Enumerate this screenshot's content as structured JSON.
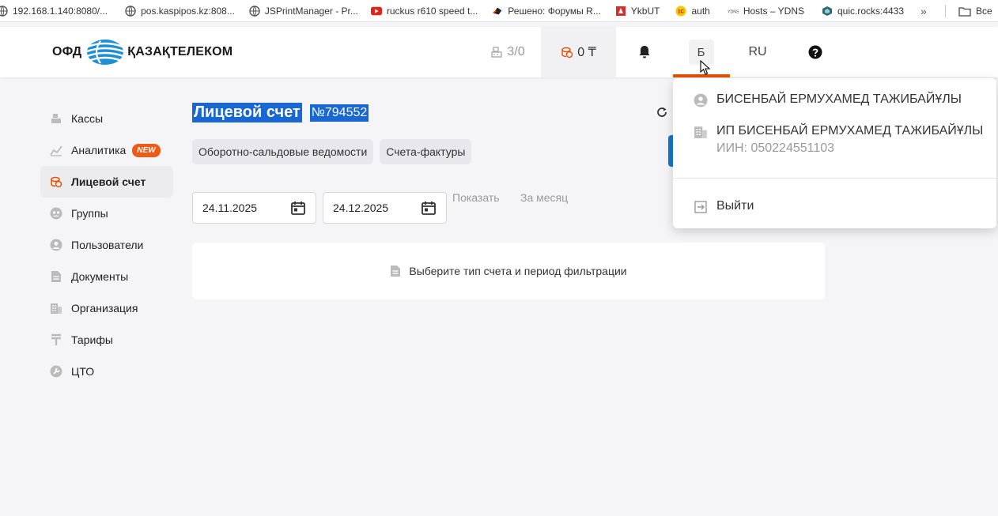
{
  "bookmarks": [
    {
      "label": "192.168.1.140:8080/...",
      "icon": "globe-icon"
    },
    {
      "label": "pos.kaspipos.kz:808...",
      "icon": "globe-icon"
    },
    {
      "label": "JSPrintManager - Pr...",
      "icon": "globe-icon"
    },
    {
      "label": "ruckus r610 speed t...",
      "icon": "youtube-icon"
    },
    {
      "label": "Решено: Форумы R...",
      "icon": "forum-icon"
    },
    {
      "label": "YkbUT",
      "icon": "ykbut-icon"
    },
    {
      "label": "auth",
      "icon": "1c-icon"
    },
    {
      "label": "Hosts – YDNS",
      "icon": "ydns-icon"
    },
    {
      "label": "quic.rocks:4433",
      "icon": "cube-icon"
    }
  ],
  "bookmarks_more": "»",
  "bookmarks_all": "Все",
  "header": {
    "logo_left": "ОФД",
    "logo_right": "ҚАЗАҚТЕЛЕКОМ",
    "kassa_count": "3/0",
    "balance": "0 ₸",
    "user_initial": "Б",
    "lang": "RU"
  },
  "sidebar": {
    "items": [
      {
        "label": "Кассы",
        "icon": "cash-register-icon"
      },
      {
        "label": "Аналитика",
        "icon": "analytics-icon",
        "badge": "NEW"
      },
      {
        "label": "Лицевой счет",
        "icon": "coins-icon",
        "active": true
      },
      {
        "label": "Группы",
        "icon": "groups-icon"
      },
      {
        "label": "Пользователи",
        "icon": "user-icon"
      },
      {
        "label": "Документы",
        "icon": "document-icon"
      },
      {
        "label": "Организация",
        "icon": "building-icon"
      },
      {
        "label": "Тарифы",
        "icon": "tariff-icon"
      },
      {
        "label": "ЦТО",
        "icon": "wrench-icon"
      }
    ]
  },
  "main": {
    "title": "Лицевой счет",
    "account_number": "№794552",
    "chips": [
      "Оборотно-сальдовые ведомости",
      "Счета-фактуры"
    ],
    "date_from": "24.11.2025",
    "date_to": "24.12.2025",
    "show_label": "Показать",
    "month_label": "За месяц",
    "empty_message": "Выберите тип счета и период фильтрации"
  },
  "dropdown": {
    "user_name": "БИСЕНБАЙ ЕРМУХАМЕД ТАЖИБАЙҰЛЫ",
    "org_name": "ИП БИСЕНБАЙ ЕРМУХАМЕД ТАЖИБАЙҰЛЫ",
    "org_iin": "ИИН: 050224551103",
    "logout": "Выйти"
  },
  "colors": {
    "accent": "#e35205",
    "selection": "#1967d2",
    "badge": "#f05a14"
  }
}
